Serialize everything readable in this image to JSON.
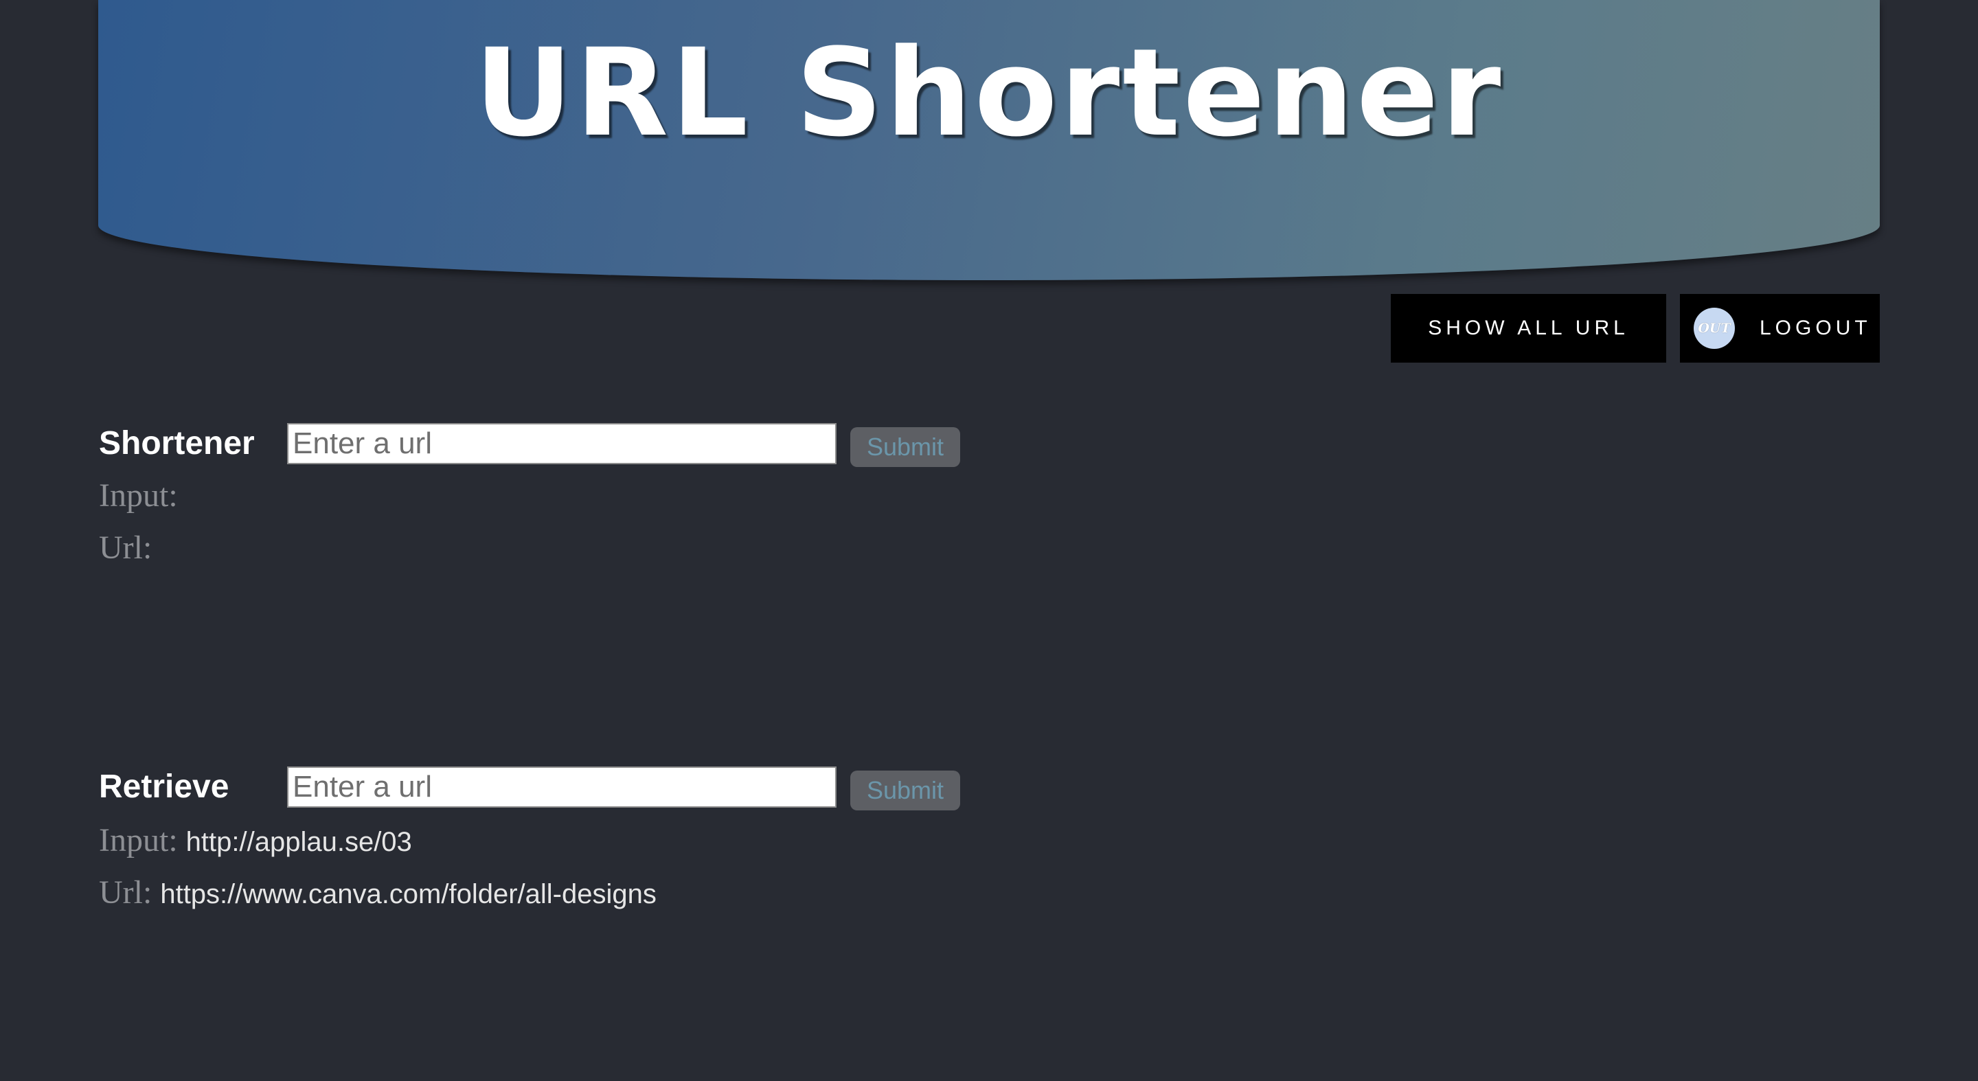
{
  "header": {
    "title": "URL Shortener"
  },
  "actions": {
    "show_all_label": "SHOW ALL URL",
    "logout_icon_text": "OUT",
    "logout_label": "LOGOUT"
  },
  "shortener": {
    "title": "Shortener",
    "placeholder": "Enter a url",
    "value": "",
    "submit_label": "Submit",
    "input_label": "Input:",
    "input_value": "",
    "url_label": "Url:",
    "url_value": ""
  },
  "retrieve": {
    "title": "Retrieve",
    "placeholder": "Enter a url",
    "value": "",
    "submit_label": "Submit",
    "input_label": "Input:",
    "input_value": "http://applau.se/03",
    "url_label": "Url:",
    "url_value": "https://www.canva.com/folder/all-designs"
  },
  "colors": {
    "background": "#282b33",
    "banner_start": "#2f5a8e",
    "banner_end": "#677f85",
    "button_dark": "#000000",
    "submit_bg": "#5d5f64",
    "submit_text": "#6b96aa"
  }
}
